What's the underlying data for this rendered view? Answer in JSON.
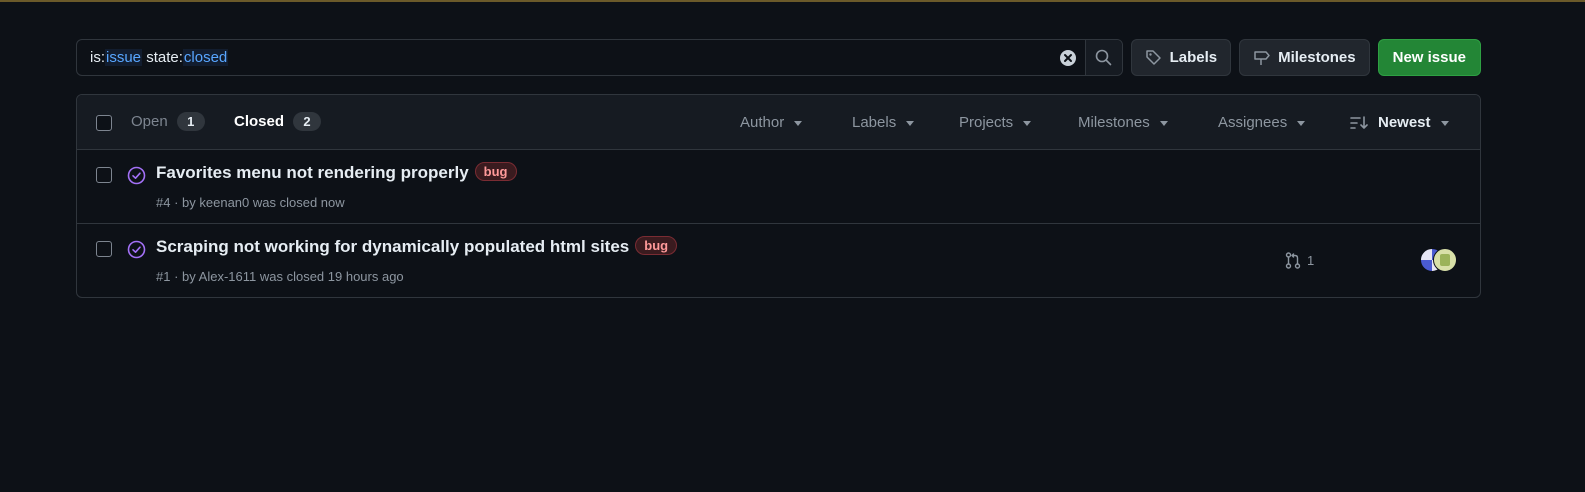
{
  "search": {
    "query_prefix": "is:",
    "query_is_value": "issue",
    "query_state_key": " state:",
    "query_state_value": "closed"
  },
  "toolbar": {
    "labels_label": "Labels",
    "milestones_label": "Milestones",
    "new_issue_label": "New issue"
  },
  "tabs": {
    "open_label": "Open",
    "open_count": "1",
    "closed_label": "Closed",
    "closed_count": "2"
  },
  "filters": {
    "author": "Author",
    "labels": "Labels",
    "projects": "Projects",
    "milestones": "Milestones",
    "assignees": "Assignees",
    "sort": "Newest"
  },
  "issues": [
    {
      "title": "Favorites menu not rendering properly",
      "label": "bug",
      "number": "#4",
      "by": " · by ",
      "author": "keenan0",
      "status": " was closed now"
    },
    {
      "title": "Scraping not working for dynamically populated html sites",
      "label": "bug",
      "number": "#1",
      "by": " · by ",
      "author": "Alex-1611",
      "status": " was closed 19 hours ago",
      "linked_prs": "1"
    }
  ],
  "colors": {
    "background": "#0d1117",
    "primary_button": "#238636",
    "closed_icon": "#a371f7",
    "bug_label": "#ff9a9a",
    "highlight": "#58a6ff"
  }
}
